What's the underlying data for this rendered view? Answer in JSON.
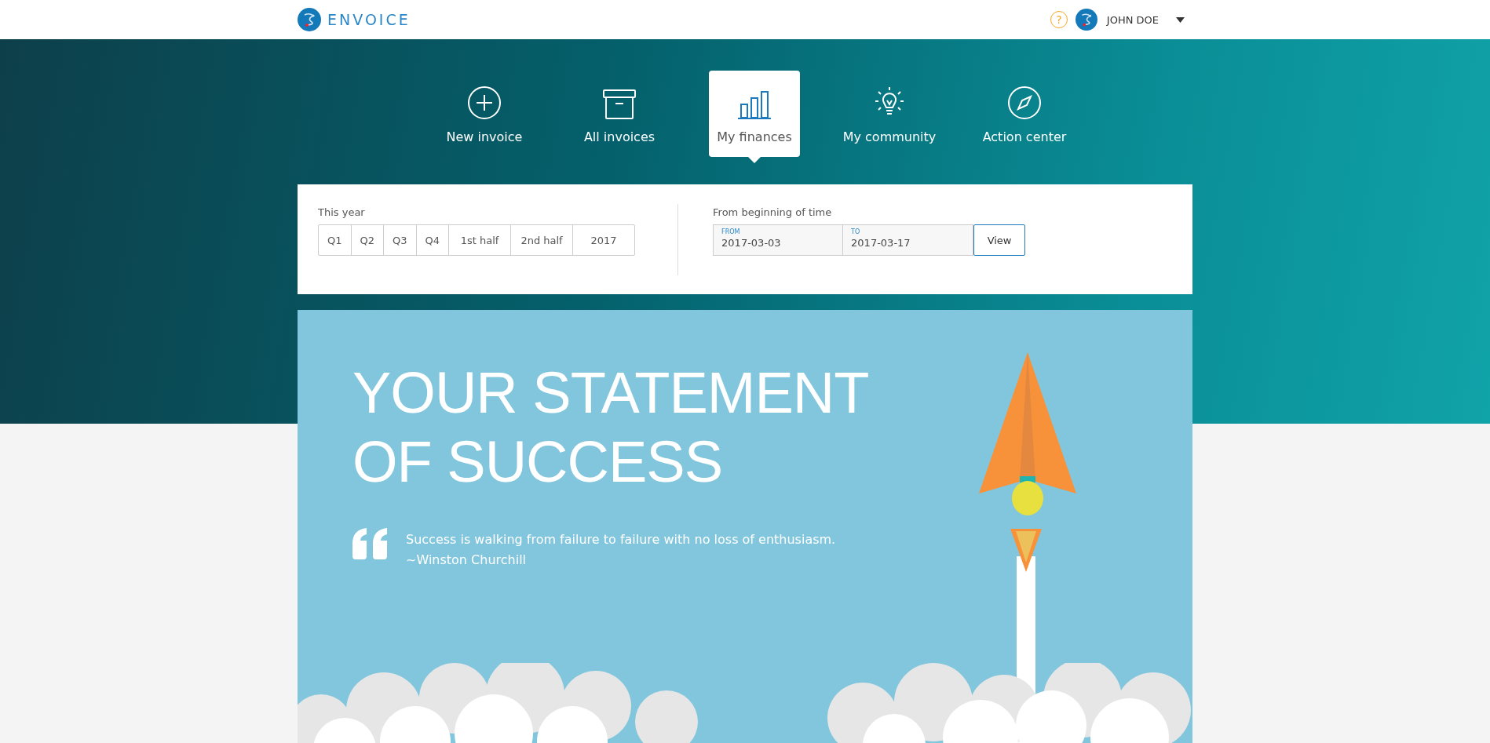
{
  "header": {
    "logo": "ENVOICE",
    "help": "?",
    "user": "JOHN DOE"
  },
  "nav": [
    {
      "label": "New invoice",
      "kind": "plus",
      "selected": false
    },
    {
      "label": "All invoices",
      "kind": "archive",
      "selected": false
    },
    {
      "label": "My finances",
      "kind": "chart",
      "selected": true
    },
    {
      "label": "My community",
      "kind": "bulb",
      "selected": false
    },
    {
      "label": "Action center",
      "kind": "compass",
      "selected": false
    }
  ],
  "filters": {
    "preset_label": "This year",
    "presets": [
      {
        "label": "Q1",
        "selected": false
      },
      {
        "label": "Q2",
        "selected": false
      },
      {
        "label": "Q3",
        "selected": false
      },
      {
        "label": "Q4",
        "selected": false
      },
      {
        "label": "1st half",
        "selected": false
      },
      {
        "label": "2nd half",
        "selected": false
      },
      {
        "label": "2017",
        "selected": false
      }
    ],
    "range_label": "From beginning of time",
    "from": {
      "label": "FROM",
      "value": "2017-03-03"
    },
    "to": {
      "label": "TO",
      "value": "2017-03-17"
    },
    "view_button": "View"
  },
  "hero": {
    "title_lines": [
      "YOUR STATEMENT",
      "OF SUCCESS"
    ],
    "quote": "Success is walking from failure to failure with no loss of enthusiasm.",
    "author": "~Winston Churchill"
  }
}
